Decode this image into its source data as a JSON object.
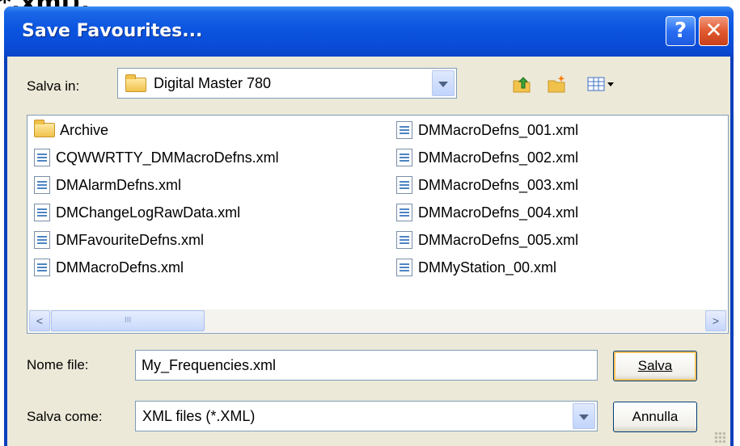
{
  "background_text": "*.xml).",
  "dialog": {
    "title": "Save Favourites...",
    "help_label": "?",
    "close_label": "✕"
  },
  "save_in": {
    "label": "Salva in:",
    "folder": "Digital Master 780"
  },
  "toolbar": {
    "icons": [
      "up-folder-icon",
      "new-folder-icon",
      "view-menu-icon"
    ]
  },
  "files": {
    "col1": [
      {
        "name": "Archive",
        "type": "folder"
      },
      {
        "name": "CQWWRTTY_DMMacroDefns.xml",
        "type": "file"
      },
      {
        "name": "DMAlarmDefns.xml",
        "type": "file"
      },
      {
        "name": "DMChangeLogRawData.xml",
        "type": "file"
      },
      {
        "name": "DMFavouriteDefns.xml",
        "type": "file"
      },
      {
        "name": "DMMacroDefns.xml",
        "type": "file"
      }
    ],
    "col2": [
      {
        "name": "DMMacroDefns_001.xml",
        "type": "file"
      },
      {
        "name": "DMMacroDefns_002.xml",
        "type": "file"
      },
      {
        "name": "DMMacroDefns_003.xml",
        "type": "file"
      },
      {
        "name": "DMMacroDefns_004.xml",
        "type": "file"
      },
      {
        "name": "DMMacroDefns_005.xml",
        "type": "file"
      },
      {
        "name": "DMMyStation_00.xml",
        "type": "file"
      }
    ]
  },
  "scrollbar": {
    "left_arrow": "<",
    "right_arrow": ">",
    "thumb_grip": "III"
  },
  "filename": {
    "label": "Nome file:",
    "value": "My_Frequencies.xml"
  },
  "filetype": {
    "label": "Salva come:",
    "value": "XML files (*.XML)"
  },
  "buttons": {
    "save": "Salva",
    "cancel": "Annulla"
  }
}
